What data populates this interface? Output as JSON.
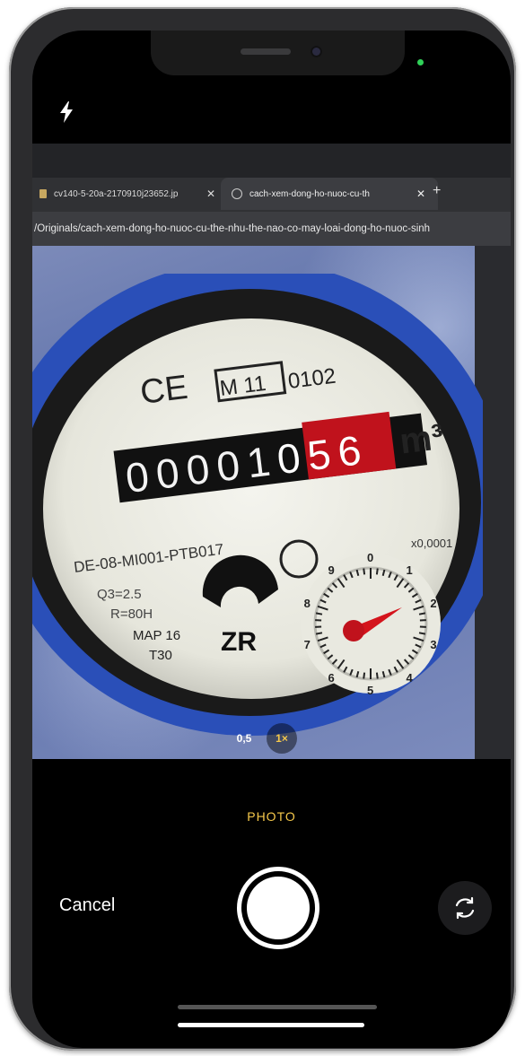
{
  "status": {
    "sensor_color": "#30d158"
  },
  "camera": {
    "flash_icon": "bolt-icon",
    "mode_label": "PHOTO",
    "cancel_label": "Cancel",
    "flip_icon": "camera-flip-icon",
    "zoom_options": [
      "0,5",
      "1×"
    ],
    "zoom_selected": "1×",
    "accent": "#f5c84b"
  },
  "browser": {
    "tabs": [
      {
        "label": "cv140-5-20a-2170910j23652.jp"
      },
      {
        "label": "cach-xem-dong-ho-nuoc-cu-th"
      }
    ],
    "new_tab": "+",
    "url": "/Originals/cach-xem-dong-ho-nuoc-cu-the-nhu-the-nao-co-may-loai-dong-ho-nuoc-sinh"
  },
  "meter": {
    "ce": "CE",
    "model": "M 11",
    "code": "0102",
    "digits_black": [
      "0",
      "0",
      "0",
      "0",
      "1"
    ],
    "digits_red": [
      "0",
      "5",
      "6"
    ],
    "unit": "m³",
    "serial": "DE-08-MI001-PTB017",
    "specs": [
      "Q3=2.5",
      "R=80H",
      "MAP 16",
      "T30"
    ],
    "brand": "ZR",
    "dial_multiplier": "x0,0001",
    "dial_numbers": [
      "0",
      "1",
      "2",
      "3",
      "4",
      "5",
      "6",
      "7",
      "8",
      "9"
    ]
  }
}
